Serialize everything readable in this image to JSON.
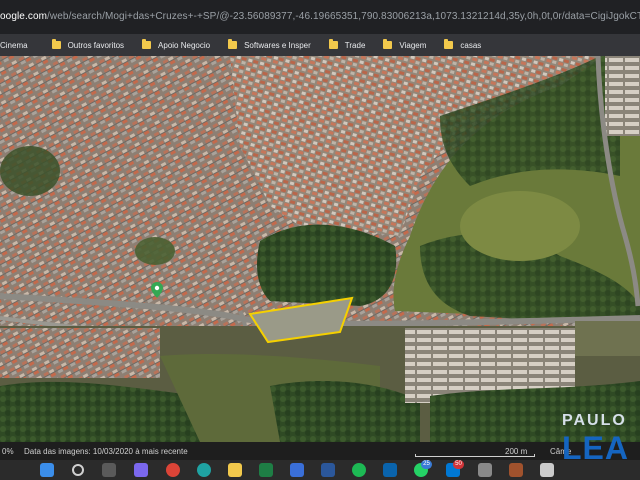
{
  "browser": {
    "url_host": "oogle.com",
    "url_path": "/web/search/Mogi+das+Cruzes+-+SP/@-23.56089377,-46.19665351,790.83006213a,1073.1321214d,35y,0h,0t,0r/data=CigiJgokCT..."
  },
  "bookmarks": [
    {
      "label": "Cinema",
      "icon": "folder-icon"
    },
    {
      "label": "Outros favoritos",
      "icon": "folder-icon"
    },
    {
      "label": "Apoio Negocio",
      "icon": "folder-icon"
    },
    {
      "label": "Softwares e Insper",
      "icon": "folder-icon"
    },
    {
      "label": "Trade",
      "icon": "folder-icon"
    },
    {
      "label": "Viagem",
      "icon": "folder-icon"
    },
    {
      "label": "casas",
      "icon": "folder-icon"
    }
  ],
  "map": {
    "type": "satellite",
    "highlight_color": "#f5d000",
    "pin_color": "#34a853"
  },
  "footer": {
    "zoom": "0%",
    "image_date": "Data das imagens: 10/03/2020 à mais recente",
    "scale": "200 m",
    "camera": "Câme"
  },
  "watermark": {
    "top": "PAULO",
    "bottom": "LEA"
  },
  "taskbar": {
    "badge_1": "25",
    "badge_2": "50",
    "icons": [
      "windows-icon",
      "search-icon",
      "taskview-icon",
      "chat-icon",
      "chrome-icon",
      "edge-icon",
      "folder-icon",
      "excel-icon",
      "store-icon",
      "word-icon",
      "spotify-icon",
      "outlook-icon",
      "whatsapp-icon",
      "mail-icon",
      "app-icon",
      "app-icon",
      "app-icon",
      "app-icon",
      "app-icon"
    ]
  }
}
